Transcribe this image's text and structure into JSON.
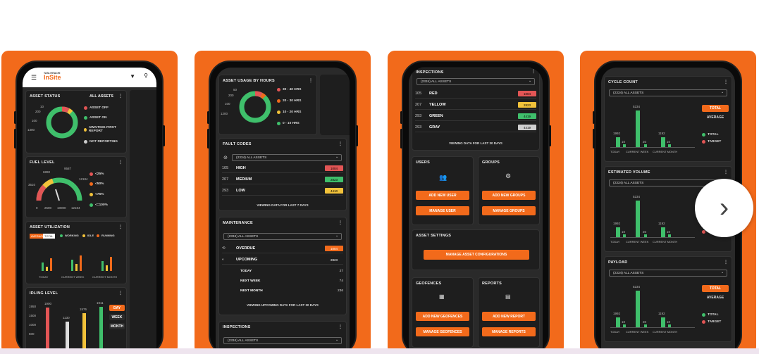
{
  "app": {
    "logo_top": "TATA HITACHI",
    "logo_main": "InSite"
  },
  "card1": {
    "asset_status": {
      "title": "ASSET STATUS",
      "filter": "ALL ASSETS",
      "legend": [
        "ASSET OFF",
        "ASSET ON",
        "AWAITING FIRST REPORT",
        "NOT REPORTING"
      ],
      "axis": [
        "10",
        "200",
        "100",
        "1300"
      ]
    },
    "fuel_level": {
      "title": "FUEL LEVEL",
      "legend": [
        "<25%",
        "<50%",
        "<75%",
        "<=100%"
      ],
      "labels": [
        "6890",
        "9587",
        "3510",
        "12184",
        "0",
        "2500",
        "10000",
        "12184"
      ]
    },
    "asset_utilization": {
      "title": "ASSET UTILIZATION",
      "toggle": [
        "AVERAGE",
        "TOTAL"
      ],
      "legend": [
        "WORKING",
        "IDLE",
        "RUNNING"
      ],
      "groups": [
        "TODAY",
        "CURRENT WEEK",
        "CURRENT MONTH"
      ]
    },
    "idling_level": {
      "title": "IDLING LEVEL",
      "y": [
        "1950",
        "1500",
        "1000",
        "500"
      ],
      "bars": [
        "1900",
        "1130",
        "1576",
        "1911"
      ],
      "buttons": [
        "DAY",
        "WEEK",
        "MONTH"
      ]
    }
  },
  "card2": {
    "asset_usage": {
      "title": "ASSET USAGE BY HOURS",
      "legend": [
        "30 - 40 HRS",
        "20 - 30 HRS",
        "10 - 20 HRS",
        "0 - 10 HRS"
      ],
      "axis": [
        "50",
        "200",
        "100",
        "1200"
      ]
    },
    "fault_codes": {
      "title": "FAULT CODES",
      "filter": "(2334) ALL ASSETS",
      "rows": [
        {
          "n": "105",
          "label": "HIGH",
          "v": "1004",
          "c": "#e25555"
        },
        {
          "n": "207",
          "label": "MEDIUM",
          "v": "2823",
          "c": "#3fbf6b"
        },
        {
          "n": "293",
          "label": "LOW",
          "v": "4410",
          "c": "#f2c23a"
        }
      ],
      "footer": "VIEWING DATA FOR LAST 7 DAYS"
    },
    "maintenance": {
      "title": "MAINTENANCE",
      "filter": "(2334) ALL ASSETS",
      "overdue": "OVERDUE",
      "overdue_v": "1004",
      "upcoming": "UPCOMING",
      "upcoming_v": "2823",
      "sub": [
        {
          "label": "TODAY",
          "v": "27"
        },
        {
          "label": "NEXT WEEK",
          "v": "74"
        },
        {
          "label": "NEXT MONTH",
          "v": "236"
        }
      ],
      "footer": "VIEWING UPCOMING DATA FOR LAST 30 DAYS"
    },
    "inspections": {
      "title": "INSPECTIONS",
      "filter": "(2334) ALL ASSETS"
    }
  },
  "card3": {
    "inspections": {
      "title": "INSPECTIONS",
      "filter": "(2334) ALL ASSETS",
      "rows": [
        {
          "n": "105",
          "label": "RED",
          "v": "1004",
          "c": "#e25555"
        },
        {
          "n": "207",
          "label": "YELLOW",
          "v": "2823",
          "c": "#f2c23a"
        },
        {
          "n": "293",
          "label": "GREEN",
          "v": "4419",
          "c": "#3fbf6b"
        },
        {
          "n": "293",
          "label": "GRAY",
          "v": "4419",
          "c": "#cfcfcf"
        }
      ],
      "footer": "VIEWING DATA FOR LAST 30 DAYS"
    },
    "users": {
      "title": "USERS",
      "add": "ADD NEW USER",
      "manage": "MANAGE USER"
    },
    "groups": {
      "title": "GROUPS",
      "add": "ADD NEW GROUPS",
      "manage": "MANAGE GROUPS"
    },
    "settings": {
      "title": "ASSET SETTINGS",
      "btn": "MANAGE ASSET CONFIGURATIONS"
    },
    "geofences": {
      "title": "GEOFENCES",
      "add": "ADD NEW GEOFENCES",
      "manage": "MANAGE GEOFENCES"
    },
    "reports": {
      "title": "REPORTS",
      "add": "ADD NEW REPORT",
      "manage": "MANAGE REPORTS"
    }
  },
  "card4": {
    "sections": [
      {
        "title": "CYCLE COUNT",
        "filter": "(2334) ALL ASSETS"
      },
      {
        "title": "ESTIMATED VOLUME",
        "filter": "(2334) ALL ASSETS"
      },
      {
        "title": "PAYLOAD",
        "filter": "(2334) ALL ASSETS"
      }
    ],
    "toggle": [
      "TOTAL",
      "AVERAGE"
    ],
    "legend": [
      "TOTAL",
      "TARGET"
    ],
    "groups": [
      "TODAY",
      "CURRENT WEEK",
      "CURRENT MONTH"
    ],
    "vals": [
      "1992",
      "10",
      "5234",
      "20",
      "1192",
      "10"
    ]
  },
  "carousel": {
    "next": "›"
  }
}
